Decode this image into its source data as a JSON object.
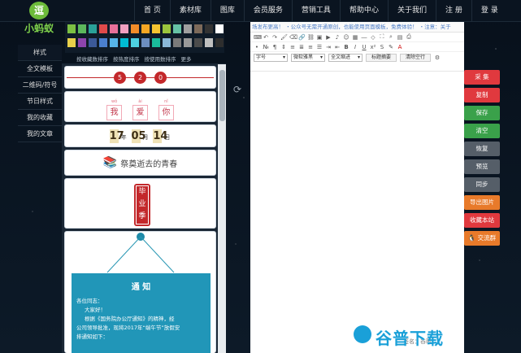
{
  "logo": {
    "badge": "逗",
    "text": "小蚂蚁"
  },
  "nav": [
    "首 页",
    "素材库",
    "图库",
    "会员服务",
    "营销工具",
    "帮助中心",
    "关于我们",
    "注 册",
    "登 录"
  ],
  "sidebar": [
    "样式",
    "全文模板",
    "二维码/符号",
    "节日样式",
    "我的收藏",
    "我的文章"
  ],
  "palette": [
    "#7cc043",
    "#5cb85c",
    "#2aa198",
    "#e04a4a",
    "#e8709a",
    "#f0a0c0",
    "#f28c28",
    "#f5a623",
    "#f4c430",
    "#9bc53d",
    "#66c2a5",
    "#a0a0a0",
    "#7d6a5a",
    "#333333",
    "#ffffff",
    "#e8d04a",
    "#8e44ad",
    "#3b5998",
    "#4a7fcf",
    "#56b4e9",
    "#00bcd4",
    "#4dd0e1",
    "#6c8ebf",
    "#1abc9c",
    "#8ab8d8",
    "#7a7a7a",
    "#999999",
    "#4b4b4b",
    "#c0c0c0",
    "#2e2e2e"
  ],
  "tabs": [
    "按收藏数排序",
    "按热度排序",
    "按使用数排序",
    "更多"
  ],
  "templates": {
    "numbers": [
      "5",
      "2",
      "0"
    ],
    "pinyin": [
      {
        "py": "wǒ",
        "hz": "我"
      },
      {
        "py": "ài",
        "hz": "爱"
      },
      {
        "py": "nǐ",
        "hz": "你"
      }
    ],
    "date": {
      "year": "17",
      "y_unit": "年",
      "month": "05",
      "m_unit": "月",
      "day": "14",
      "d_unit": "日"
    },
    "youth": "祭奠逝去的青春",
    "graduation": [
      "毕",
      "业",
      "季"
    ],
    "notice": {
      "title": "通 知",
      "lines": [
        "各位同志：",
        "大家好！",
        "根据《国务院办公厅通知》的精神，经",
        "公司领导批准，现将2017年“端午节”放假安",
        "排通知如下："
      ]
    }
  },
  "editor": {
    "ticker": "场发布更高！    ・公众号无需开通原创，也能使用页面模板，免费体验！    ・注意：关于",
    "font_size": "字号",
    "font_family": "微软雅黑",
    "indent": "全文缩进",
    "btn_title_summary": "标题摘要",
    "btn_clear": "清除空行",
    "signature": "签名：谷歌"
  },
  "actions": [
    {
      "label": "采 集",
      "color": "#e0393e"
    },
    {
      "label": "复制",
      "color": "#e0393e"
    },
    {
      "label": "保存",
      "color": "#3aa14a"
    },
    {
      "label": "清空",
      "color": "#3aa14a"
    },
    {
      "label": "恢复",
      "color": "#555e68"
    },
    {
      "label": "预览",
      "color": "#555e68"
    },
    {
      "label": "同步",
      "color": "#555e68"
    },
    {
      "label": "导出图片",
      "color": "#e87a2a"
    },
    {
      "label": "收藏本站",
      "color": "#e0393e"
    },
    {
      "label": "交流群",
      "color": "#e87a2a"
    }
  ],
  "watermark": "谷普下载",
  "icons": {
    "refresh": "refresh-icon",
    "book": "books-icon",
    "qq": "qq-icon"
  }
}
